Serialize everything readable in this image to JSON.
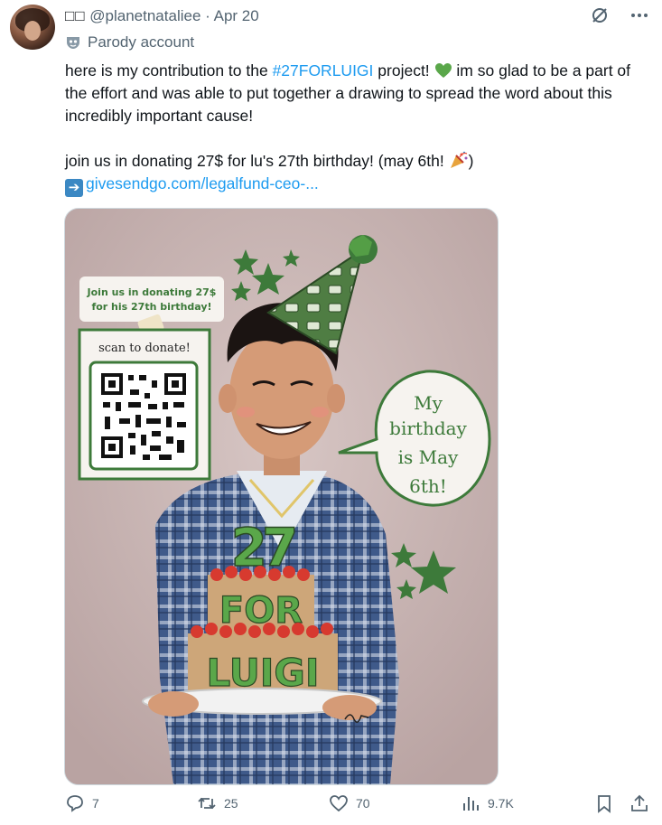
{
  "header": {
    "display_name": "□□",
    "handle": "@planetnataliee",
    "separator": "·",
    "date": "Apr 20",
    "parody_label": "Parody account"
  },
  "tweet": {
    "line1_before": "here is my contribution to the ",
    "hashtag": "#27FORLUIGI",
    "line1_after": " project! ",
    "line1_rest": " im so glad to be a part of the effort and was able to put together a drawing to spread the word about this incredibly important cause!",
    "line2": "join us in donating 27$ for lu's 27th birthday! (may 6th! ",
    "line2_end": ")",
    "link_text": "givesendgo.com/legalfund-ceo-..."
  },
  "image": {
    "sign_text_1": "Join us in donating 27$",
    "sign_text_2": "for his 27th birthday!",
    "qr_label": "scan to donate!",
    "bubble_1": "My",
    "bubble_2": "birthday",
    "bubble_3": "is May",
    "bubble_4": "6th!",
    "cake_number": "27",
    "cake_text_1": "FOR",
    "cake_text_2": "LUIGI"
  },
  "actions": {
    "replies": "7",
    "reposts": "25",
    "likes": "70",
    "views": "9.7K"
  },
  "colors": {
    "link": "#1d9bf0",
    "muted": "#536471",
    "text": "#0f1419",
    "green": "#3d7a3a"
  }
}
